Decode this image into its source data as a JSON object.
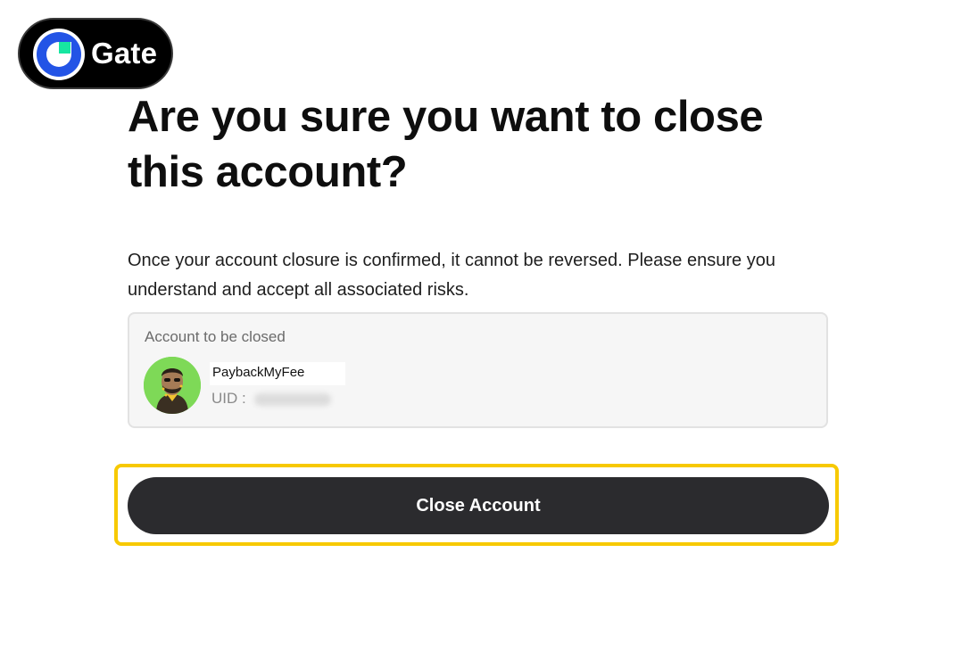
{
  "brand": {
    "name": "Gate",
    "logo_icon": "gate-logo-icon",
    "colors": {
      "badge_bg": "#000000",
      "logo_blue": "#2354e6",
      "logo_green": "#17e6a1"
    }
  },
  "dialog": {
    "title": "Are you sure you want to close this account?",
    "warning": "Once your account closure is confirmed, it cannot be reversed. Please ensure you understand and accept all associated risks."
  },
  "account_card": {
    "label": "Account to be closed",
    "avatar_icon": "user-avatar",
    "username": "PaybackMyFee",
    "uid_label": "UID :"
  },
  "actions": {
    "close_account_label": "Close Account",
    "button_color": "#2b2b2e",
    "highlight_color": "#f7c900"
  }
}
